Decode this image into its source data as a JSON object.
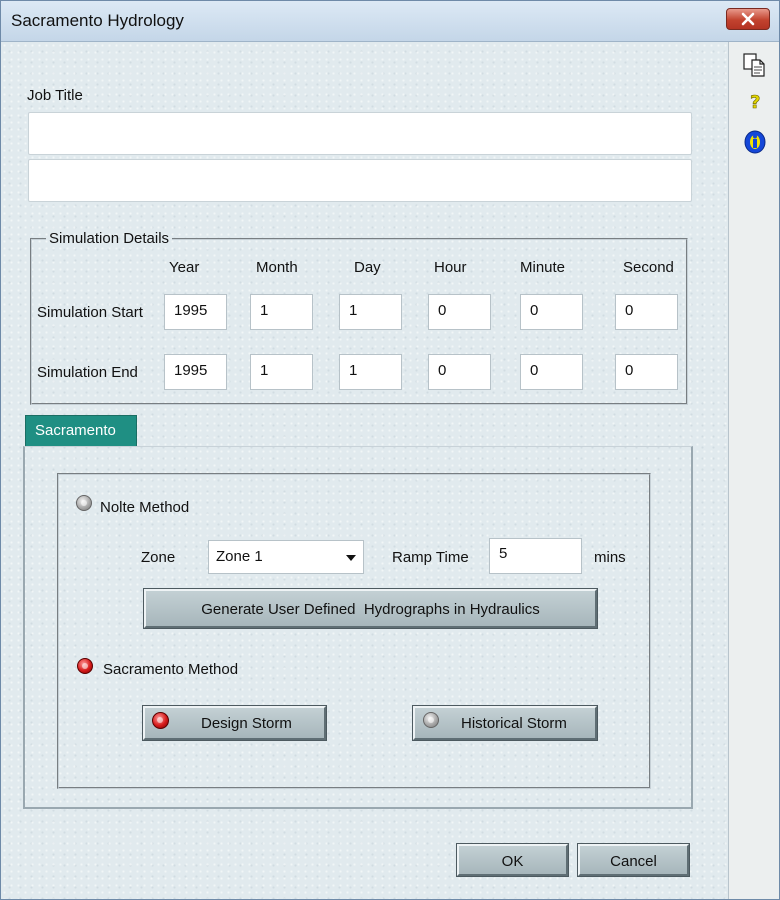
{
  "window": {
    "title": "Sacramento Hydrology"
  },
  "side_toolbar": {
    "icons": [
      "copy-icon",
      "help-icon",
      "info-icon"
    ]
  },
  "job_title": {
    "label": "Job Title",
    "line1": "",
    "line2": ""
  },
  "simulation": {
    "group_label": "Simulation Details",
    "columns": [
      "Year",
      "Month",
      "Day",
      "Hour",
      "Minute",
      "Second"
    ],
    "start": {
      "label": "Simulation Start",
      "values": [
        "1995",
        "1",
        "1",
        "0",
        "0",
        "0"
      ]
    },
    "end": {
      "label": "Simulation End",
      "values": [
        "1995",
        "1",
        "1",
        "0",
        "0",
        "0"
      ]
    }
  },
  "tabs": [
    {
      "label": "Sacramento",
      "active": true
    }
  ],
  "sacramento": {
    "nolte_label": "Nolte Method",
    "nolte_selected": false,
    "zone_label": "Zone",
    "zone_value": "Zone 1",
    "ramp_label": "Ramp Time",
    "ramp_value": "5",
    "ramp_unit": "mins",
    "generate_button": "Generate User Defined  Hydrographs in Hydraulics",
    "sac_label": "Sacramento Method",
    "sac_selected": true,
    "design_storm": {
      "label": "Design Storm",
      "selected": true
    },
    "historical_storm": {
      "label": "Historical Storm",
      "selected": false
    }
  },
  "footer": {
    "ok": "OK",
    "cancel": "Cancel"
  },
  "colors": {
    "tab_active": "#1f8f83",
    "radio_on": "#d61a1a",
    "close_button": "#c2432f"
  }
}
